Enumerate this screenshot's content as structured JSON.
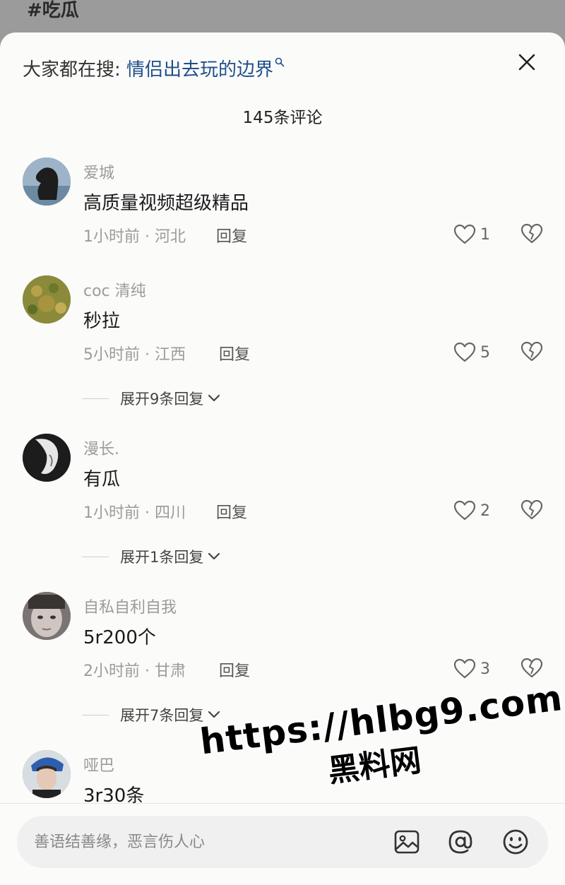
{
  "background": {
    "hashtag": "#吃瓜"
  },
  "header": {
    "search_prefix": "大家都在搜:",
    "search_query": "情侣出去玩的边界",
    "comment_count": "145条评论"
  },
  "reply_label": "回复",
  "comments": [
    {
      "username": "爱城",
      "text": "高质量视频超级精品",
      "meta": "1小时前 · 河北",
      "likes": "1",
      "expand_label": ""
    },
    {
      "username": "coc 清纯",
      "text": "秒拉",
      "meta": "5小时前 · 江西",
      "likes": "5",
      "expand_label": "展开9条回复"
    },
    {
      "username": "漫长.",
      "text": "有瓜",
      "meta": "1小时前 · 四川",
      "likes": "2",
      "expand_label": "展开1条回复"
    },
    {
      "username": "自私自利自我",
      "text": "5r200个",
      "meta": "2小时前 · 甘肃",
      "likes": "3",
      "expand_label": "展开7条回复"
    },
    {
      "username": "哑巴",
      "text": "3r30条",
      "meta": "",
      "likes": "",
      "expand_label": ""
    }
  ],
  "composer": {
    "placeholder": "善语结善缘，恶言伤人心"
  },
  "watermark": {
    "url": "https://hlbg9.com",
    "name": "黑料网"
  },
  "colors": {
    "accent_link": "#1f4f8a",
    "sheet_bg": "#fbfbfa",
    "muted_text": "#9b9b9b"
  }
}
